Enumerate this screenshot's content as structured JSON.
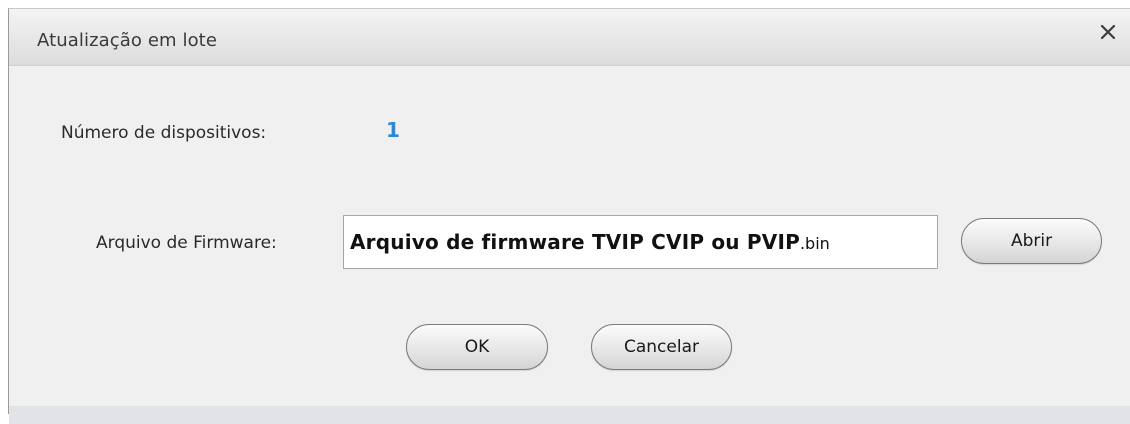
{
  "dialog": {
    "title": "Atualização em lote",
    "close_glyph": "✕",
    "close_icon": "close-icon"
  },
  "devices": {
    "label": "Número de dispositivos:",
    "count": "1",
    "count_color": "#2f86d4"
  },
  "firmware": {
    "label": "Arquivo de Firmware:",
    "value_main": "Arquivo de firmware TVIP CVIP ou PVIP",
    "value_ext": ".bin",
    "open_label": "Abrir"
  },
  "actions": {
    "ok_label": "OK",
    "cancel_label": "Cancelar"
  }
}
